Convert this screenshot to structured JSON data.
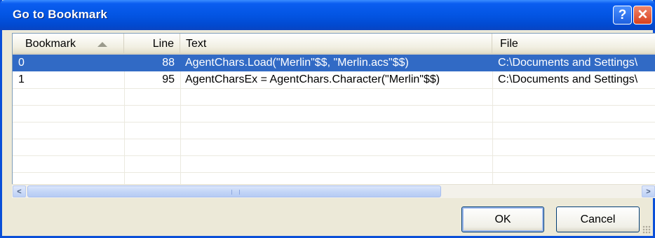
{
  "window": {
    "title": "Go to Bookmark",
    "help_glyph": "?",
    "close_glyph": "✕"
  },
  "columns": {
    "bookmark": "Bookmark",
    "line": "Line",
    "text": "Text",
    "file": "File"
  },
  "rows": [
    {
      "bookmark": "0",
      "line": "88",
      "text": "AgentChars.Load(\"Merlin\"$$, \"Merlin.acs\"$$)",
      "file": "C:\\Documents and Settings\\",
      "selected": true
    },
    {
      "bookmark": "1",
      "line": "95",
      "text": "AgentCharsEx = AgentChars.Character(\"Merlin\"$$)",
      "file": "C:\\Documents and Settings\\",
      "selected": false
    }
  ],
  "scrollbar": {
    "left_arrow": "<",
    "right_arrow": ">"
  },
  "buttons": {
    "ok": "OK",
    "cancel": "Cancel"
  },
  "colors": {
    "title_bar": "#0355e3",
    "selection": "#316ac5",
    "close_button": "#d8401c"
  },
  "sort": {
    "column": "bookmark",
    "direction": "ascending"
  }
}
